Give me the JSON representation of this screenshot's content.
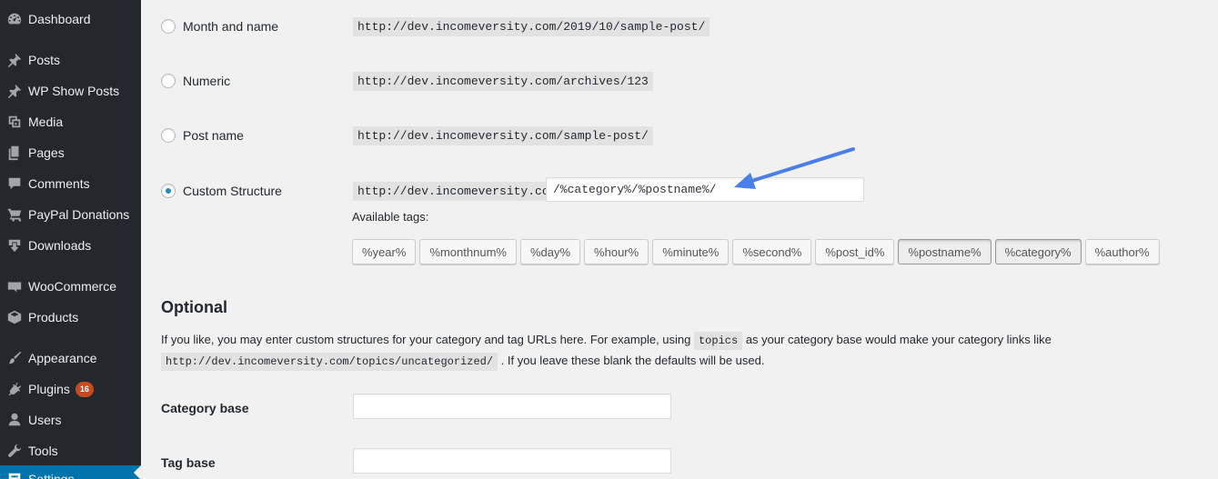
{
  "sidebar": {
    "items": [
      {
        "label": "Dashboard",
        "icon": "dashboard-icon"
      },
      {
        "label": "Posts",
        "icon": "pushpin-icon"
      },
      {
        "label": "WP Show Posts",
        "icon": "pushpin-icon"
      },
      {
        "label": "Media",
        "icon": "media-icon"
      },
      {
        "label": "Pages",
        "icon": "pages-icon"
      },
      {
        "label": "Comments",
        "icon": "comment-icon"
      },
      {
        "label": "PayPal Donations",
        "icon": "cart-icon"
      },
      {
        "label": "Downloads",
        "icon": "download-icon"
      },
      {
        "label": "WooCommerce",
        "icon": "woo-icon"
      },
      {
        "label": "Products",
        "icon": "archive-icon"
      },
      {
        "label": "Appearance",
        "icon": "brush-icon"
      },
      {
        "label": "Plugins",
        "icon": "plugin-icon",
        "badge": "16"
      },
      {
        "label": "Users",
        "icon": "user-icon"
      },
      {
        "label": "Tools",
        "icon": "wrench-icon"
      },
      {
        "label": "Settings",
        "icon": "settings-icon"
      }
    ]
  },
  "permalinks": {
    "options": [
      {
        "label": "Month and name",
        "example": "http://dev.incomeversity.com/2019/10/sample-post/",
        "checked": false
      },
      {
        "label": "Numeric",
        "example": "http://dev.incomeversity.com/archives/123",
        "checked": false
      },
      {
        "label": "Post name",
        "example": "http://dev.incomeversity.com/sample-post/",
        "checked": false
      },
      {
        "label": "Custom Structure",
        "example": "http://dev.incomeversity.com",
        "checked": true
      }
    ],
    "custom_value": "/%category%/%postname%/",
    "available_tags_label": "Available tags:",
    "tags": [
      {
        "label": "%year%",
        "active": false
      },
      {
        "label": "%monthnum%",
        "active": false
      },
      {
        "label": "%day%",
        "active": false
      },
      {
        "label": "%hour%",
        "active": false
      },
      {
        "label": "%minute%",
        "active": false
      },
      {
        "label": "%second%",
        "active": false
      },
      {
        "label": "%post_id%",
        "active": false
      },
      {
        "label": "%postname%",
        "active": true
      },
      {
        "label": "%category%",
        "active": true
      },
      {
        "label": "%author%",
        "active": false
      }
    ]
  },
  "optional": {
    "title": "Optional",
    "desc_part1": "If you like, you may enter custom structures for your category and tag URLs here. For example, using ",
    "desc_code1": "topics",
    "desc_part2": " as your category base would make your category links like",
    "desc_code2": "http://dev.incomeversity.com/topics/uncategorized/",
    "desc_part3": " . If you leave these blank the defaults will be used.",
    "category_base_label": "Category base",
    "category_base_value": "",
    "tag_base_label": "Tag base",
    "tag_base_value": ""
  },
  "colors": {
    "sidebar_bg": "#23282d",
    "accent": "#0073aa",
    "annotation_arrow": "#4a7ee8",
    "badge": "#ca4a1f"
  }
}
